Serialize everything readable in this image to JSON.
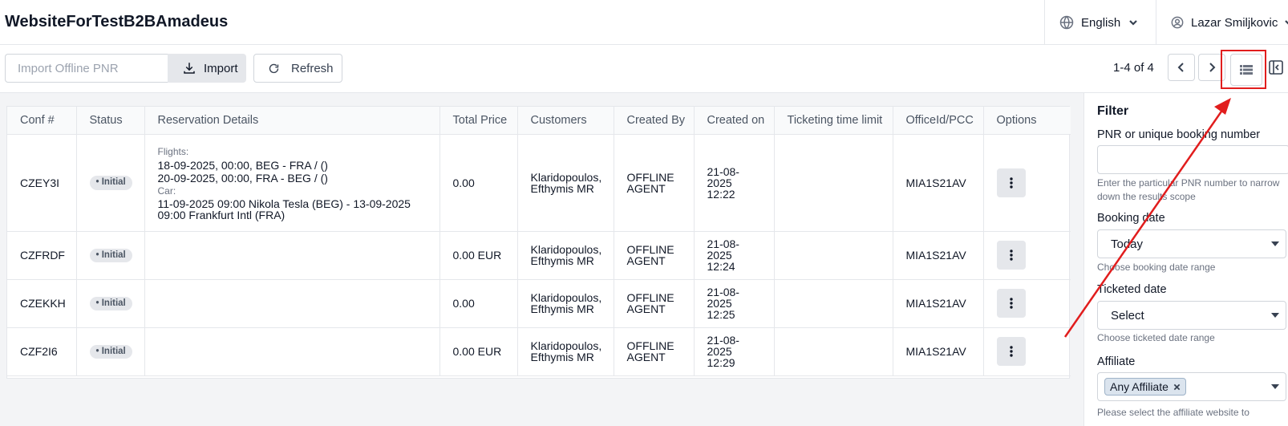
{
  "header": {
    "app_title": "WebsiteForTestB2BAmadeus",
    "language": "English",
    "user_name": "Lazar Smiljkovic"
  },
  "toolbar": {
    "pnr_placeholder": "Import Offline PNR",
    "import_label": "Import",
    "refresh_label": "Refresh",
    "range_text": "1-4 of 4"
  },
  "table": {
    "columns": [
      "Conf #",
      "Status",
      "Reservation Details",
      "Total Price",
      "Customers",
      "Created By",
      "Created on",
      "Ticketing time limit",
      "OfficeId/PCC",
      "Options"
    ],
    "rows": [
      {
        "conf": "CZEY3I",
        "status": "• Initial",
        "flights_label": "Flights:",
        "flight_1": "18-09-2025, 00:00, BEG - FRA / ()",
        "flight_2": "20-09-2025, 00:00, FRA - BEG / ()",
        "car_label": "Car:",
        "car_1": "11-09-2025 09:00 Nikola Tesla (BEG) - 13-09-2025",
        "car_2": "09:00 Frankfurt Intl (FRA)",
        "price": "0.00",
        "customer_1": "Klaridopoulos,",
        "customer_2": "Efthymis MR",
        "created_by_1": "OFFLINE",
        "created_by_2": "AGENT",
        "created_on_1": "21-08-",
        "created_on_2": "2025",
        "created_on_3": "12:22",
        "ttl": "",
        "office": "MIA1S21AV"
      },
      {
        "conf": "CZFRDF",
        "status": "• Initial",
        "price": "0.00 EUR",
        "customer_1": "Klaridopoulos,",
        "customer_2": "Efthymis MR",
        "created_by_1": "OFFLINE",
        "created_by_2": "AGENT",
        "created_on_1": "21-08-",
        "created_on_2": "2025",
        "created_on_3": "12:24",
        "ttl": "",
        "office": "MIA1S21AV"
      },
      {
        "conf": "CZEKKH",
        "status": "• Initial",
        "price": "0.00",
        "customer_1": "Klaridopoulos,",
        "customer_2": "Efthymis MR",
        "created_by_1": "OFFLINE",
        "created_by_2": "AGENT",
        "created_on_1": "21-08-",
        "created_on_2": "2025",
        "created_on_3": "12:25",
        "ttl": "",
        "office": "MIA1S21AV"
      },
      {
        "conf": "CZF2I6",
        "status": "• Initial",
        "price": "0.00 EUR",
        "customer_1": "Klaridopoulos,",
        "customer_2": "Efthymis MR",
        "created_by_1": "OFFLINE",
        "created_by_2": "AGENT",
        "created_on_1": "21-08-",
        "created_on_2": "2025",
        "created_on_3": "12:29",
        "ttl": "",
        "office": "MIA1S21AV"
      }
    ]
  },
  "filter": {
    "title": "Filter",
    "pnr_label": "PNR or unique booking number",
    "pnr_help": "Enter the particular PNR number to narrow down the results scope",
    "booking_date_label": "Booking date",
    "booking_date_value": "Today",
    "booking_date_help": "Choose booking date range",
    "ticketed_date_label": "Ticketed date",
    "ticketed_date_value": "Select",
    "ticketed_date_help": "Choose ticketed date range",
    "affiliate_label": "Affiliate",
    "affiliate_chip": "Any Affiliate",
    "affiliate_help": "Please select the affiliate website to"
  },
  "icons": {
    "language": "globe-icon",
    "user": "user-circle-icon",
    "import": "download-icon",
    "refresh": "refresh-icon",
    "prev": "chevron-left-icon",
    "next": "chevron-right-icon",
    "view": "list-view-icon",
    "panel": "sidebar-toggle-icon",
    "options": "vertical-dots-icon"
  },
  "colors": {
    "annotation": "#e11d1d",
    "badge_bg": "#e5e7eb",
    "chip_bg": "#dbe4ee"
  }
}
